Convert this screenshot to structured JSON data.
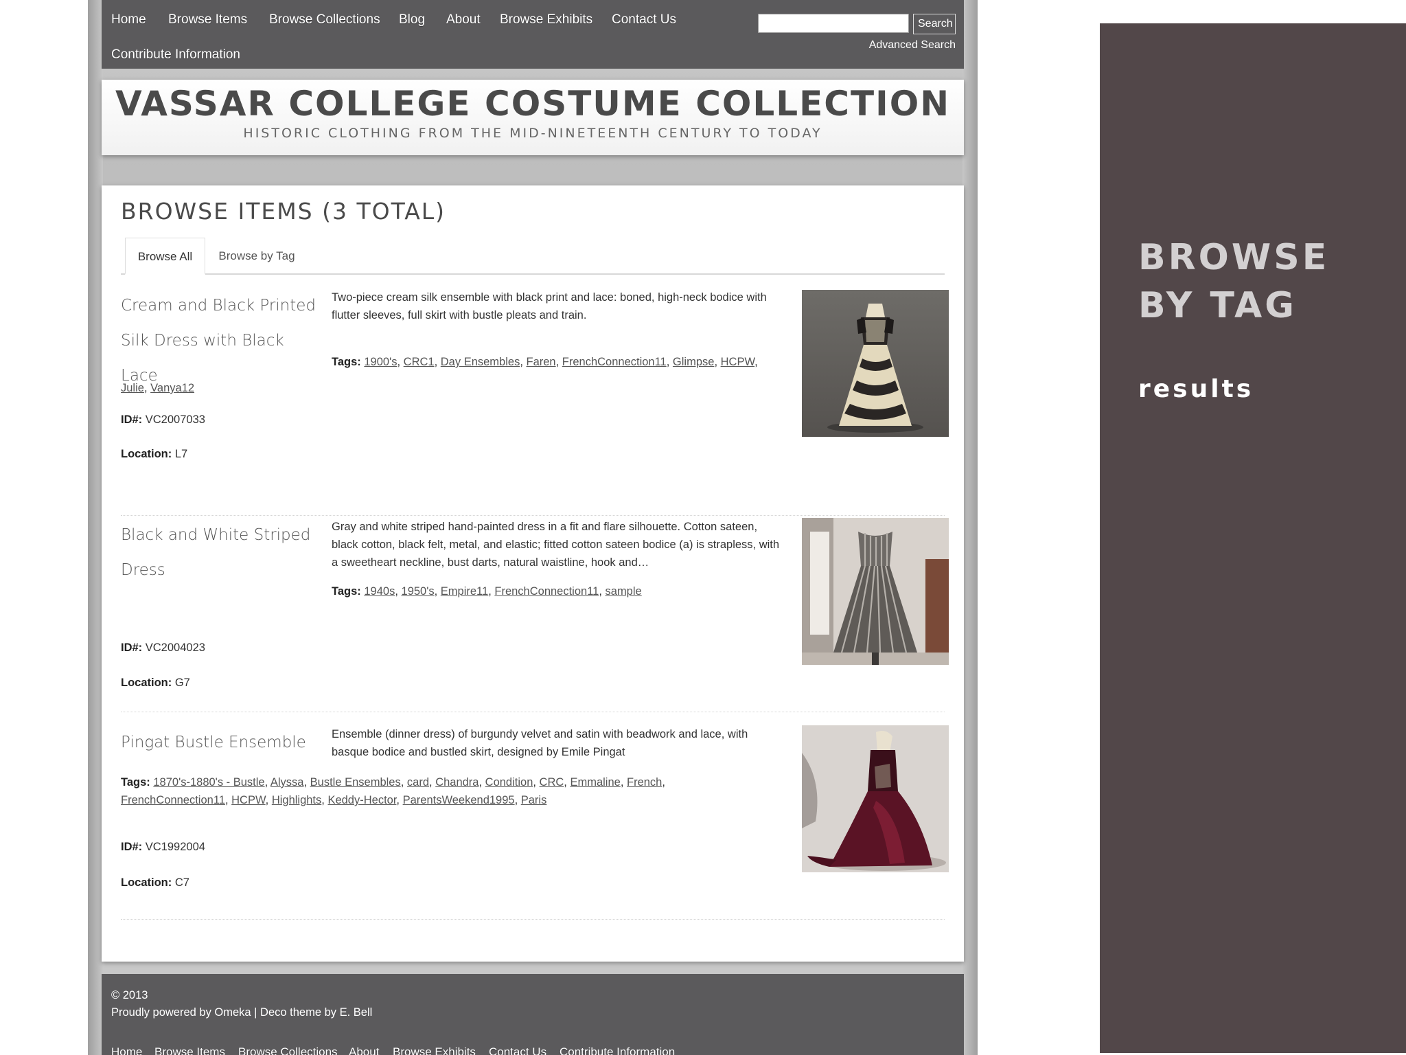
{
  "nav": {
    "items": [
      "Home",
      "Browse Items",
      "Browse Collections",
      "Blog",
      "About",
      "Browse Exhibits",
      "Contact Us",
      "Contribute Information"
    ],
    "search_button": "Search",
    "search_value": "",
    "advanced_search": "Advanced Search"
  },
  "banner": {
    "title": "VASSAR COLLEGE COSTUME COLLECTION",
    "subtitle": "HISTORIC CLOTHING FROM THE MID-NINETEENTH CENTURY TO TODAY"
  },
  "page": {
    "heading": "BROWSE ITEMS (3 TOTAL)",
    "tabs": [
      {
        "label": "Browse All",
        "active": true
      },
      {
        "label": "Browse by Tag",
        "active": false
      }
    ],
    "tags_label": "Tags:",
    "id_label": "ID#:",
    "location_label": "Location:"
  },
  "items": [
    {
      "title_line1": "Cream and Black Printed",
      "title_line2": "Silk Dress with Black Lace",
      "description": "Two-piece cream silk ensemble with black print and lace: boned, high-neck bodice with flutter sleeves, full skirt with bustle pleats and train.",
      "tags": [
        "1900's",
        "CRC1",
        "Day Ensembles",
        "Faren",
        "FrenchConnection11",
        "Glimpse",
        "HCPW",
        "Julie",
        "Vanya12"
      ],
      "id": "VC2007033",
      "location": "L7",
      "image_icon": "cream-lace-dress-photo"
    },
    {
      "title_line1": "Black and White Striped",
      "title_line2": "Dress",
      "description": "Gray and white striped hand-painted dress in a fit and flare silhouette. Cotton sateen, black cotton, black felt, metal, and elastic; fitted cotton sateen bodice (a) is strapless, with a sweetheart neckline, bust darts, natural waistline, hook and…",
      "tags": [
        "1940s",
        "1950's",
        "Empire11",
        "FrenchConnection11",
        "sample"
      ],
      "id": "VC2004023",
      "location": "G7",
      "image_icon": "striped-dress-photo"
    },
    {
      "title_line1": "Pingat Bustle Ensemble",
      "title_line2": "",
      "description": "Ensemble (dinner dress) of burgundy velvet and satin with beadwork and lace, with basque bodice and bustled skirt, designed by Emile Pingat",
      "tags": [
        "1870's-1880's - Bustle",
        "Alyssa",
        "Bustle Ensembles",
        "card",
        "Chandra",
        "Condition",
        "CRC",
        "Emmaline",
        "French",
        "FrenchConnection11",
        "HCPW",
        "Highlights",
        "Keddy-Hector",
        "ParentsWeekend1995",
        "Paris"
      ],
      "id": "VC1992004",
      "location": "C7",
      "image_icon": "burgundy-bustle-dress-photo"
    }
  ],
  "footer": {
    "copyright": "© 2013",
    "powered": "Proudly powered by Omeka | Deco theme by E. Bell",
    "nav": [
      "Home",
      "Browse Items",
      "Browse Collections",
      "About",
      "Browse Exhibits",
      "Contact Us",
      "Contribute Information"
    ]
  },
  "side_panel": {
    "title_line1": "BROWSE",
    "title_line2": "BY TAG",
    "subtitle": "results"
  },
  "colors": {
    "nav_bg": "#5b5a5c",
    "side_panel_bg": "#524749",
    "side_title": "#d3d0d1"
  }
}
